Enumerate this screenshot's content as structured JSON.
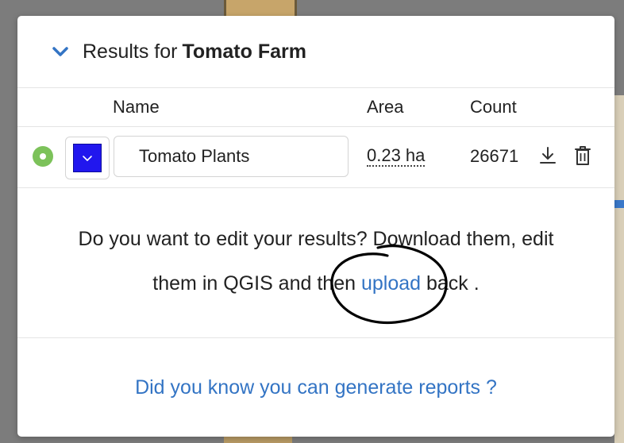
{
  "panel": {
    "title_prefix": "Results for",
    "project_name": "Tomato Farm"
  },
  "table": {
    "columns": [
      "Name",
      "Area",
      "Count"
    ]
  },
  "result": {
    "name": "Tomato Plants",
    "area": "0.23 ha",
    "count": "26671",
    "color": "#2117ee",
    "status_color": "#7cc25a"
  },
  "info": {
    "line1": "Do you want to edit your results? Download them, edit",
    "line2_prefix": "them in QGIS and then ",
    "upload_link": "upload",
    "line2_suffix": " back ."
  },
  "tip": {
    "link": "Did you know you can generate reports ?"
  },
  "colors": {
    "accent": "#3374c4",
    "annotation": "#000000"
  },
  "icons": {
    "collapse": "chevron-down-icon",
    "download": "download-icon",
    "delete": "trash-icon"
  }
}
